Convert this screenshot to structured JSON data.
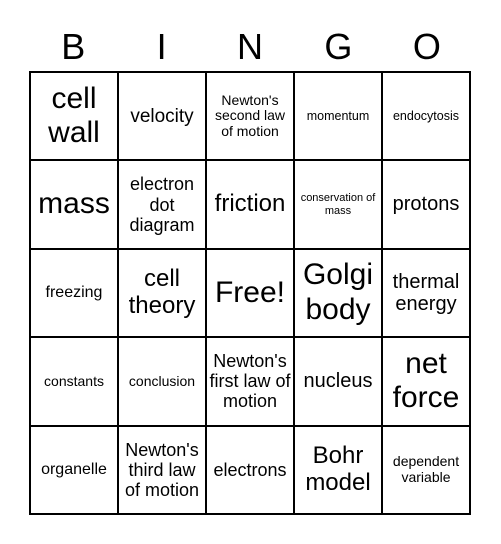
{
  "header": {
    "letters": [
      "B",
      "I",
      "N",
      "G",
      "O"
    ]
  },
  "cells": [
    "cell wall",
    "velocity",
    "Newton's second law of motion",
    "momentum",
    "endocytosis",
    "mass",
    "electron dot diagram",
    "friction",
    "conservation of mass",
    "protons",
    "freezing",
    "cell theory",
    "Free!",
    "Golgi body",
    "thermal energy",
    "constants",
    "conclusion",
    "Newton's first law of motion",
    "nucleus",
    "net force",
    "organelle",
    "Newton's third law of motion",
    "electrons",
    "Bohr model",
    "dependent variable"
  ]
}
